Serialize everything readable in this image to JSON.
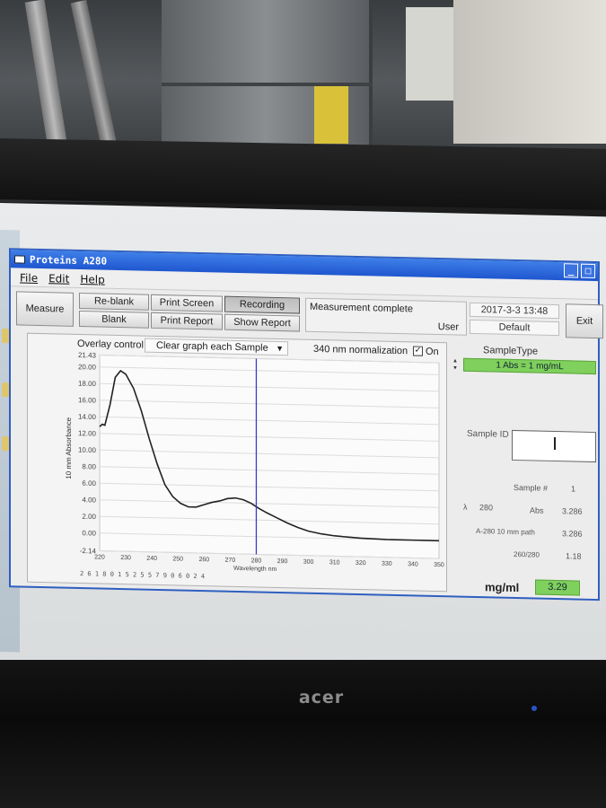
{
  "window": {
    "title": "Proteins A280",
    "menu": [
      "File",
      "Edit",
      "Help"
    ]
  },
  "toolbar": {
    "measure": "Measure",
    "reblank": "Re-blank",
    "blank": "Blank",
    "print_screen": "Print Screen",
    "print_report": "Print Report",
    "recording": "Recording",
    "show_report": "Show Report",
    "status": "Measurement complete",
    "user_label": "User",
    "datetime": "2017-3-3  13:48",
    "user_value": "Default",
    "exit": "Exit"
  },
  "graph": {
    "overlay_label": "Overlay control",
    "overlay_option": "Clear graph each Sample",
    "normalization_label": "340 nm normalization",
    "normalization_checked": "✓",
    "normalization_on": "On",
    "footer_code": "2 6 1 8 0 1 5 2 5 5 7 9 0 6 0 2 4"
  },
  "chart_data": {
    "type": "line",
    "xlabel": "Wavelength nm",
    "ylabel": "10 mm Absorbance",
    "xlim": [
      220,
      350
    ],
    "ylim": [
      -2.14,
      21.43
    ],
    "x_ticks": [
      220,
      230,
      240,
      250,
      260,
      270,
      280,
      290,
      300,
      310,
      320,
      330,
      340,
      350
    ],
    "y_ticks": [
      "21.43",
      "20.00",
      "18.00",
      "16.00",
      "14.00",
      "12.00",
      "10.00",
      "8.00",
      "6.00",
      "4.00",
      "2.00",
      "0.00",
      "-2.14"
    ],
    "y_tick_values": [
      21.43,
      20,
      18,
      16,
      14,
      12,
      10,
      8,
      6,
      4,
      2,
      0,
      -2.14
    ],
    "marker_x": 280,
    "series": [
      {
        "x": [
          220,
          221,
          222,
          224,
          226,
          228,
          230,
          233,
          236,
          239,
          242,
          245,
          248,
          251,
          254,
          257,
          260,
          263,
          266,
          269,
          272,
          275,
          278,
          281,
          284,
          288,
          292,
          296,
          300,
          305,
          310,
          315,
          320,
          325,
          330,
          335,
          340,
          345,
          350
        ],
        "y": [
          12.8,
          13.1,
          13.0,
          15.5,
          18.8,
          19.6,
          19.2,
          17.5,
          14.8,
          11.5,
          8.5,
          6.0,
          4.6,
          3.8,
          3.4,
          3.4,
          3.7,
          4.0,
          4.2,
          4.5,
          4.6,
          4.4,
          4.0,
          3.4,
          2.9,
          2.3,
          1.7,
          1.2,
          0.8,
          0.5,
          0.3,
          0.2,
          0.1,
          0.05,
          0.0,
          0.0,
          0.0,
          0.0,
          0.0
        ]
      }
    ]
  },
  "results": {
    "sample_type_label": "SampleType",
    "sample_type_value": "1 Abs = 1 mg/mL",
    "sample_id_label": "Sample ID",
    "sample_no_label": "Sample #",
    "sample_no_value": "1",
    "lambda_label": "λ",
    "lambda_value": "280",
    "abs_label": "Abs",
    "abs_value": "3.286",
    "a280_label": "A-280 10 mm path",
    "a280_value": "3.286",
    "ratio_label": "260/280",
    "ratio_value": "1.18",
    "mgml_label": "mg/ml",
    "mgml_value": "3.29"
  },
  "monitor": {
    "brand": "acer"
  },
  "colors": {
    "titlebar": "#1f56cf",
    "green_field": "#7fd05c",
    "marker_line": "#3a3ac8",
    "curve": "#222222"
  }
}
